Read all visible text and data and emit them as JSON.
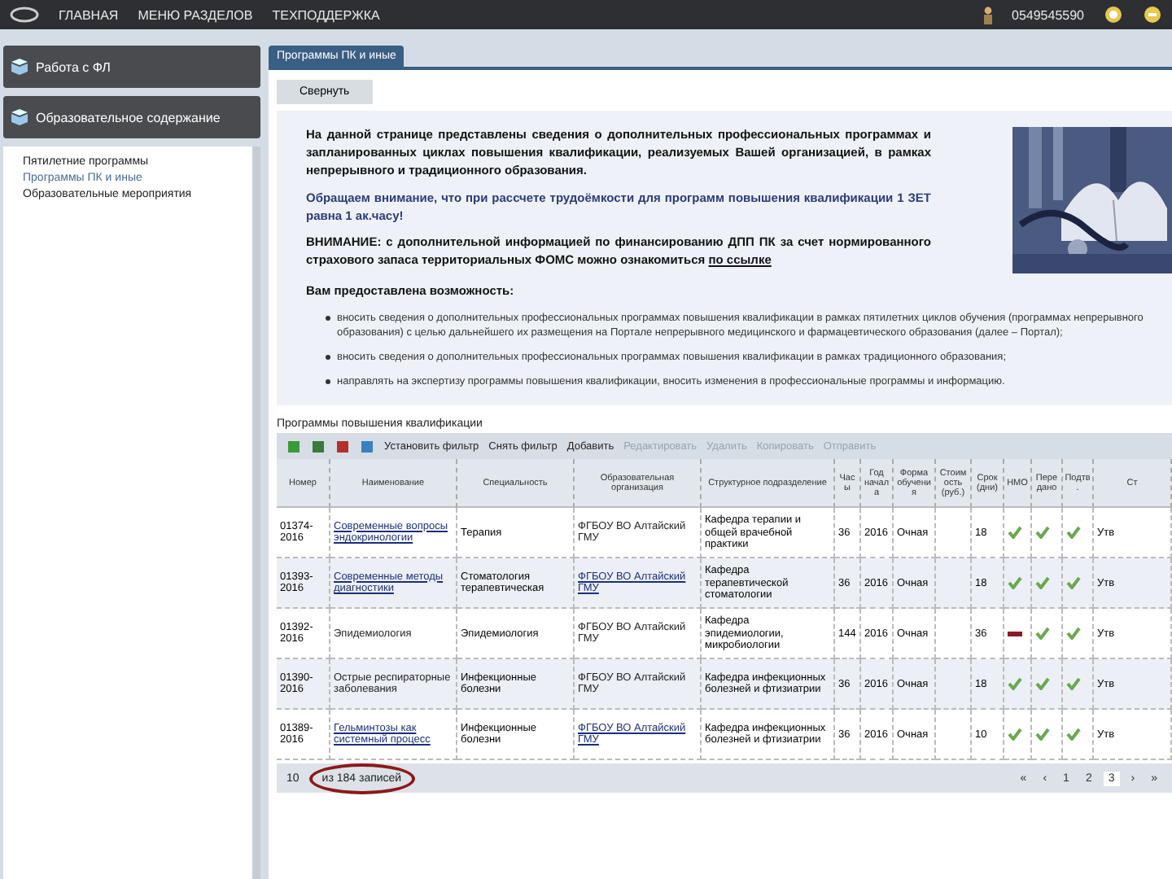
{
  "topbar": {
    "nav": [
      "ГЛАВНАЯ",
      "МЕНЮ РАЗДЕЛОВ",
      "ТЕХПОДДЕРЖКА"
    ],
    "user": "0549545590"
  },
  "sidebar": {
    "sections": [
      {
        "label": "Работа с ФЛ"
      },
      {
        "label": "Образовательное содержание"
      }
    ],
    "items": [
      {
        "label": "Пятилетние программы",
        "selected": false
      },
      {
        "label": "Программы ПК и иные",
        "selected": true
      },
      {
        "label": "Образовательные мероприятия",
        "selected": false
      }
    ]
  },
  "tabs": [
    {
      "label": "Программы ПК и иные",
      "selected": true
    }
  ],
  "collapse_button": "Свернуть",
  "info": {
    "intro": "На данной странице представлены сведения о дополнительных профессиональных программах и запланированных циклах повышения квалификации, реализуемых Вашей организацией, в рамках непрерывного и традиционного образования.",
    "notice": "Обращаем внимание, что при рассчете трудоёмкости для программ повышения квалификации 1 ЗЕТ равна 1 ак.часу!",
    "warning": "ВНИМАНИЕ: с дополнительной информацией по финансированию ДПП ПК за счет нормированного страхового запаса территориальных ФОМС можно ознакомиться",
    "warning_link": "по ссылке",
    "possibilities_title": "Вам предоставлена возможность:",
    "possibilities": [
      "вносить сведения о дополнительных профессиональных программах повышения квалификации в рамках пятилетних циклов обучения (программах непрерывного образования) с целью дальнейшего их размещения на Портале непрерывного медицинского и фармацевтического образования (далее – Портал);",
      "вносить сведения о дополнительных профессиональных программах повышения квалификации в рамках традиционного образования;",
      "направлять на экспертизу программы повышения квалификации, вносить изменения в профессиональные программы и информацию."
    ]
  },
  "grid": {
    "title": "Программы повышения квалификации",
    "toolbar": [
      {
        "kind": "icon"
      },
      {
        "kind": "icon"
      },
      {
        "kind": "icon"
      },
      {
        "kind": "icon"
      },
      {
        "kind": "action",
        "label": "Установить фильтр",
        "disabled": false
      },
      {
        "kind": "action",
        "label": "Снять фильтр",
        "disabled": false
      },
      {
        "kind": "action",
        "label": "Добавить",
        "disabled": false
      },
      {
        "kind": "action",
        "label": "Редактировать",
        "disabled": true
      },
      {
        "kind": "action",
        "label": "Удалить",
        "disabled": true
      },
      {
        "kind": "action",
        "label": "Копировать",
        "disabled": true
      },
      {
        "kind": "action",
        "label": "Отправить",
        "disabled": true
      }
    ],
    "columns": [
      "Номер",
      "Наименование",
      "Специальность",
      "Образовательная организация",
      "Структурное подразделение",
      "Часы",
      "Год начала",
      "Форма обучения",
      "Стоимость (руб.)",
      "Срок (дни)",
      "НМО",
      "Передано",
      "Подтв.",
      "Ст"
    ],
    "rows": [
      {
        "number": "01374-2016",
        "name": "Современные вопросы эндокринологии",
        "name_link": true,
        "specialty": "Терапия",
        "org": "ФГБОУ ВО Алтайский ГМУ",
        "org_link": false,
        "dept": "Кафедра терапии и общей врачебной практики",
        "hours": "36",
        "year": "2016",
        "form": "Очная",
        "cost": "",
        "term": "18",
        "nmo": true,
        "sent": true,
        "confirmed": true,
        "status": "Утв"
      },
      {
        "number": "01393-2016",
        "name": "Современные методы диагностики",
        "name_link": true,
        "specialty": "Стоматология терапевтическая",
        "org": "ФГБОУ ВО Алтайский ГМУ",
        "org_link": true,
        "dept": "Кафедра терапевтической стоматологии",
        "hours": "36",
        "year": "2016",
        "form": "Очная",
        "cost": "",
        "term": "18",
        "nmo": true,
        "sent": true,
        "confirmed": true,
        "status": "Утв"
      },
      {
        "number": "01392-2016",
        "name": "Эпидемиология",
        "name_link": false,
        "specialty": "Эпидемиология",
        "org": "ФГБОУ ВО Алтайский ГМУ",
        "org_link": false,
        "dept": "Кафедра эпидемиологии, микробиологии",
        "hours": "144",
        "year": "2016",
        "form": "Очная",
        "cost": "",
        "term": "36",
        "nmo": false,
        "sent": true,
        "confirmed": true,
        "status": "Утв"
      },
      {
        "number": "01390-2016",
        "name": "Острые респираторные заболевания",
        "name_link": false,
        "specialty": "Инфекционные болезни",
        "org": "ФГБОУ ВО Алтайский ГМУ",
        "org_link": false,
        "dept": "Кафедра инфекционных болезней и фтизиатрии",
        "hours": "36",
        "year": "2016",
        "form": "Очная",
        "cost": "",
        "term": "18",
        "nmo": true,
        "sent": true,
        "confirmed": true,
        "status": "Утв"
      },
      {
        "number": "01389-2016",
        "name": "Гельминтозы как системный процесс",
        "name_link": true,
        "specialty": "Инфекционные болезни",
        "org": "ФГБОУ ВО Алтайский ГМУ",
        "org_link": true,
        "dept": "Кафедра инфекционных болезней и фтизиатрии",
        "hours": "36",
        "year": "2016",
        "form": "Очная",
        "cost": "",
        "term": "10",
        "nmo": true,
        "sent": true,
        "confirmed": true,
        "status": "Утв"
      }
    ],
    "footer": {
      "page_size": "10",
      "total": "из 184 записей",
      "pages": [
        {
          "label": "«",
          "selected": false
        },
        {
          "label": "‹",
          "selected": false
        },
        {
          "label": "1",
          "selected": false
        },
        {
          "label": "2",
          "selected": false
        },
        {
          "label": "3",
          "selected": true
        },
        {
          "label": "›",
          "selected": false
        },
        {
          "label": "»",
          "selected": false
        }
      ]
    }
  }
}
